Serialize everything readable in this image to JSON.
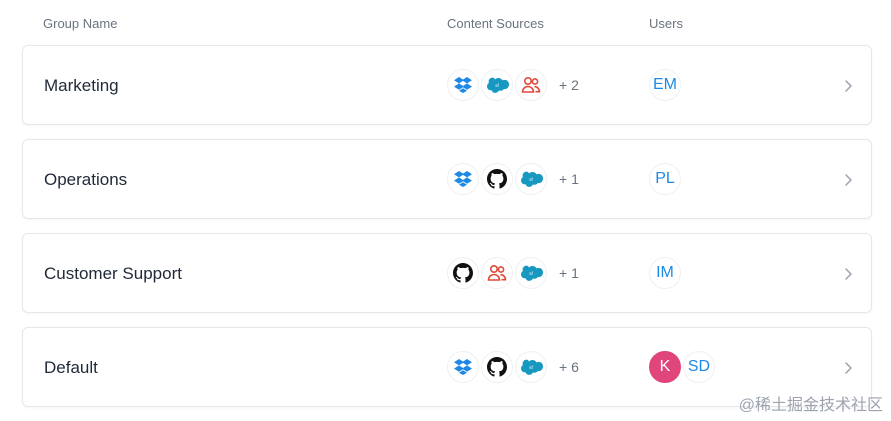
{
  "header": {
    "group_name": "Group Name",
    "content_sources": "Content Sources",
    "users": "Users"
  },
  "colors": {
    "dropbox": "#1e88e5",
    "salesforce": "#1798c1",
    "people": "#e0493b",
    "github": "#111111",
    "user_initials": "#1e88e5",
    "user_k_bg": "#e0457b"
  },
  "groups": [
    {
      "name": "Marketing",
      "sources": [
        "dropbox-icon",
        "salesforce-icon",
        "people-icon"
      ],
      "more": "+ 2",
      "users": [
        {
          "initials": "EM",
          "style": "outline"
        }
      ]
    },
    {
      "name": "Operations",
      "sources": [
        "dropbox-icon",
        "github-icon",
        "salesforce-icon"
      ],
      "more": "+ 1",
      "users": [
        {
          "initials": "PL",
          "style": "outline"
        }
      ]
    },
    {
      "name": "Customer Support",
      "sources": [
        "github-icon",
        "people-icon",
        "salesforce-icon"
      ],
      "more": "+ 1",
      "users": [
        {
          "initials": "IM",
          "style": "outline"
        }
      ]
    },
    {
      "name": "Default",
      "sources": [
        "dropbox-icon",
        "github-icon",
        "salesforce-icon"
      ],
      "more": "+ 6",
      "users": [
        {
          "initials": "K",
          "style": "solid"
        },
        {
          "initials": "SD",
          "style": "outline"
        }
      ]
    }
  ],
  "watermark": "@稀土掘金技术社区"
}
